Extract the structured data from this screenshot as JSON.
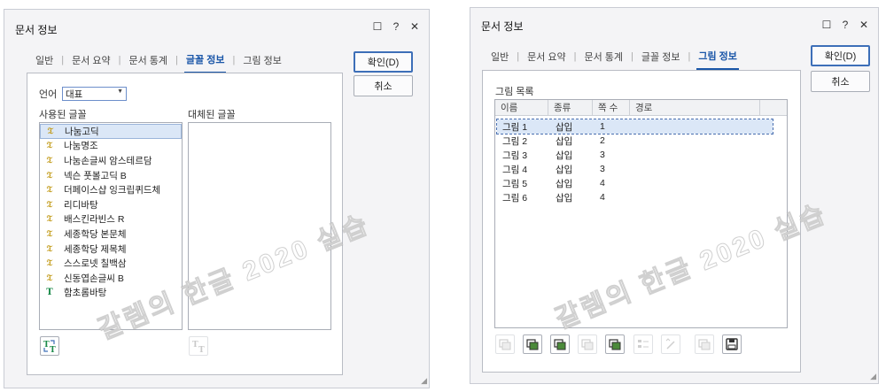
{
  "left_dialog": {
    "title": "문서 정보",
    "tabs": [
      {
        "label": "일반",
        "active": false
      },
      {
        "label": "문서 요약",
        "active": false
      },
      {
        "label": "문서 통계",
        "active": false
      },
      {
        "label": "글꼴 정보",
        "active": true
      },
      {
        "label": "그림 정보",
        "active": false
      }
    ],
    "ok_label": "확인(D)",
    "cancel_label": "취소",
    "language_label": "언어",
    "language_value": "대표",
    "used_fonts_label": "사용된 글꼴",
    "substituted_fonts_label": "대체된 글꼴",
    "used_fonts": [
      {
        "name": "나눔고딕",
        "icon": "font-icon",
        "selected": true
      },
      {
        "name": "나눔명조",
        "icon": "font-icon",
        "selected": false
      },
      {
        "name": "나눔손글씨 암스테르담",
        "icon": "font-icon",
        "selected": false
      },
      {
        "name": "넥슨 풋볼고딕 B",
        "icon": "font-icon",
        "selected": false
      },
      {
        "name": "더페이스샵 잉크립퀴드체",
        "icon": "font-icon",
        "selected": false
      },
      {
        "name": "리디바탕",
        "icon": "font-icon",
        "selected": false
      },
      {
        "name": "배스킨라빈스 R",
        "icon": "font-icon",
        "selected": false
      },
      {
        "name": "세종학당 본문체",
        "icon": "font-icon",
        "selected": false
      },
      {
        "name": "세종학당 제목체",
        "icon": "font-icon",
        "selected": false
      },
      {
        "name": "스스로넷 칠백삼",
        "icon": "font-icon",
        "selected": false
      },
      {
        "name": "신동엽손글씨 B",
        "icon": "font-icon",
        "selected": false
      },
      {
        "name": "함초롬바탕",
        "icon": "truetype-font-icon",
        "selected": false
      }
    ],
    "watermark": "갈렘의 한글 2020 실습"
  },
  "right_dialog": {
    "title": "문서 정보",
    "tabs": [
      {
        "label": "일반",
        "active": false
      },
      {
        "label": "문서 요약",
        "active": false
      },
      {
        "label": "문서 통계",
        "active": false
      },
      {
        "label": "글꼴 정보",
        "active": false
      },
      {
        "label": "그림 정보",
        "active": true
      }
    ],
    "ok_label": "확인(D)",
    "cancel_label": "취소",
    "picture_list_label": "그림 목록",
    "columns": [
      "이름",
      "종류",
      "쪽 수",
      "경로"
    ],
    "rows": [
      {
        "name": "그림 1",
        "type": "삽입",
        "page": "1",
        "path": "",
        "selected": true
      },
      {
        "name": "그림 2",
        "type": "삽입",
        "page": "2",
        "path": "",
        "selected": false
      },
      {
        "name": "그림 3",
        "type": "삽입",
        "page": "3",
        "path": "",
        "selected": false
      },
      {
        "name": "그림 4",
        "type": "삽입",
        "page": "3",
        "path": "",
        "selected": false
      },
      {
        "name": "그림 5",
        "type": "삽입",
        "page": "4",
        "path": "",
        "selected": false
      },
      {
        "name": "그림 6",
        "type": "삽입",
        "page": "4",
        "path": "",
        "selected": false
      }
    ],
    "watermark": "갈렘의 한글 2020 실습"
  },
  "title_icons": [
    "comment-icon",
    "help-icon",
    "close-icon"
  ],
  "title_icon_glyphs": [
    "☐",
    "?",
    "✕"
  ],
  "accent_color": "#1a56a8"
}
